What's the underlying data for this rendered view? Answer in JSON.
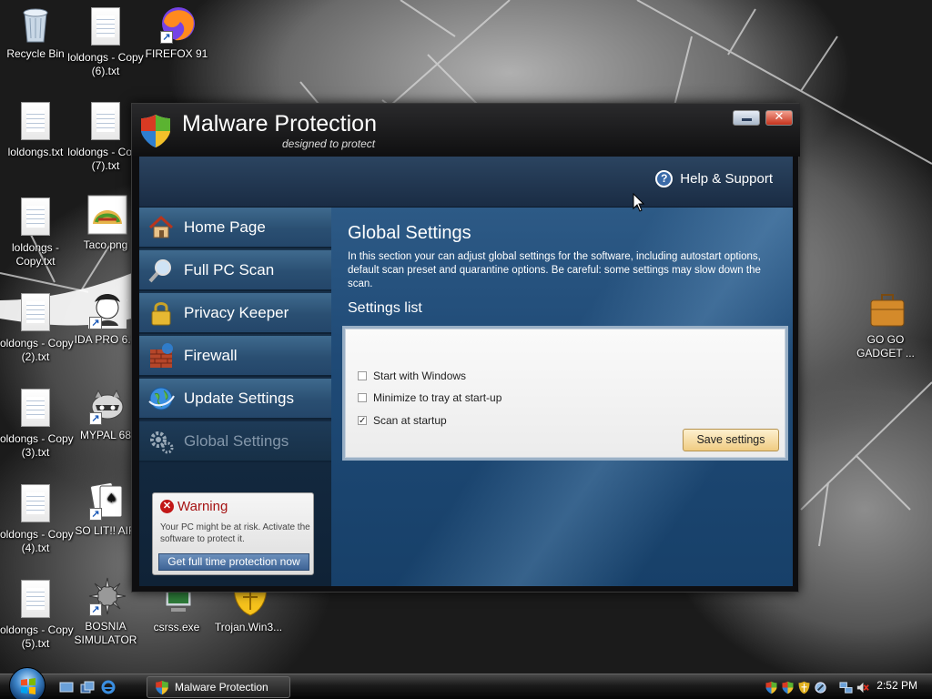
{
  "desktop": {
    "icons": [
      {
        "label": "Recycle Bin"
      },
      {
        "label": "loldongs - Copy (6).txt"
      },
      {
        "label": "FIREFOX 91"
      },
      {
        "label": "loldongs.txt"
      },
      {
        "label": "loldongs - Copy (7).txt"
      },
      {
        "label": "loldongs - Copy.txt"
      },
      {
        "label": "Taco.png"
      },
      {
        "label": "loldongs - Copy (2).txt"
      },
      {
        "label": "IDA PRO 6.2"
      },
      {
        "label": "loldongs - Copy (3).txt"
      },
      {
        "label": "MYPAL 68"
      },
      {
        "label": "loldongs - Copy (4).txt"
      },
      {
        "label": "SO LIT!! AIR"
      },
      {
        "label": "loldongs - Copy (5).txt"
      },
      {
        "label": "BOSNIA SIMULATOR"
      },
      {
        "label": "csrss.exe"
      },
      {
        "label": "Trojan.Win3..."
      },
      {
        "label": "GO GO GADGET ..."
      }
    ]
  },
  "window": {
    "title": "Malware Protection",
    "subtitle": "designed to protect",
    "help_label": "Help & Support",
    "nav": [
      {
        "label": "Home Page",
        "icon": "home-icon"
      },
      {
        "label": "Full PC Scan",
        "icon": "magnifier-icon"
      },
      {
        "label": "Privacy Keeper",
        "icon": "padlock-icon"
      },
      {
        "label": "Firewall",
        "icon": "firewall-icon"
      },
      {
        "label": "Update Settings",
        "icon": "globe-icon"
      },
      {
        "label": "Global Settings",
        "icon": "gears-icon"
      }
    ],
    "warning": {
      "title": "Warning",
      "text": "Your PC might be at risk. Activate the software to protect it.",
      "button": "Get full time protection now"
    },
    "content": {
      "title": "Global Settings",
      "description": "In this section your can adjust global settings for the software, including autostart options, default scan preset and quarantine options. Be careful: some settings may slow down the scan.",
      "list_title": "Settings list",
      "options": [
        {
          "label": "Start with Windows",
          "checked": false,
          "mark": ""
        },
        {
          "label": "Minimize to tray at start-up",
          "checked": false,
          "mark": ""
        },
        {
          "label": "Scan at startup",
          "checked": true,
          "mark": "✓"
        }
      ],
      "save_button": "Save settings"
    }
  },
  "taskbar": {
    "task_label": "Malware Protection",
    "clock": "2:52 PM"
  },
  "colors": {
    "accent": "#2a4f72",
    "warning": "#c21818",
    "save_button": "#f0cc82"
  }
}
